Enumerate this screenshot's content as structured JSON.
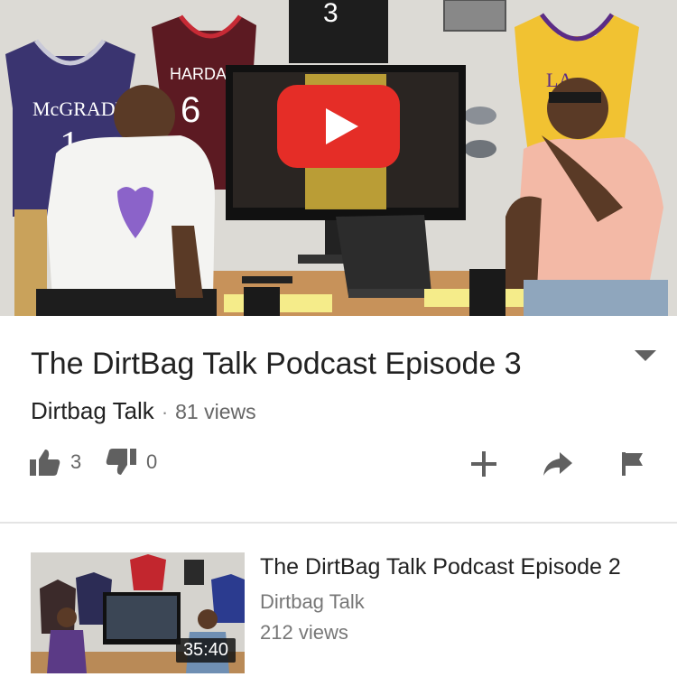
{
  "video": {
    "title": "The DirtBag Talk Podcast Episode 3",
    "channel": "Dirtbag Talk",
    "separator": "·",
    "views": "81 views",
    "jerseys": {
      "left": {
        "name": "McGRADY",
        "number": "1"
      },
      "red": {
        "name": "HARDAWAY",
        "number": "6"
      },
      "top": {
        "number": "3"
      },
      "right": {
        "name": "LA"
      }
    }
  },
  "actions": {
    "likes": "3",
    "dislikes": "0"
  },
  "up_next": {
    "title": "The DirtBag Talk Podcast Episode 2",
    "channel": "Dirtbag Talk",
    "views": "212 views",
    "duration": "35:40"
  },
  "colors": {
    "youtube_red": "#e52d27",
    "text_primary": "#222222",
    "text_secondary": "#777777",
    "icon_grey": "#606060"
  },
  "icons": [
    "play-icon",
    "chevron-down-icon",
    "thumbs-up-icon",
    "thumbs-down-icon",
    "add-icon",
    "share-icon",
    "flag-icon"
  ]
}
